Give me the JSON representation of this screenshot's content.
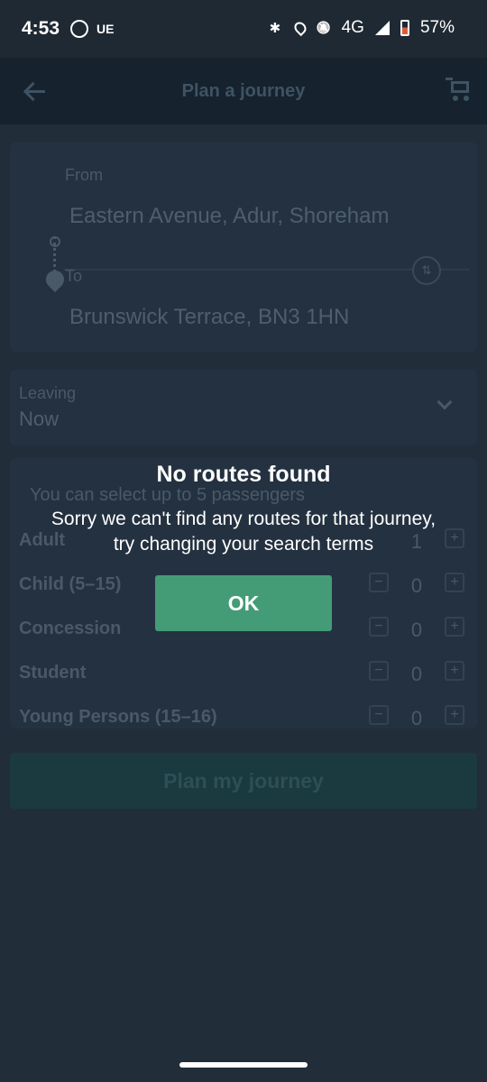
{
  "status_bar": {
    "time": "4:53",
    "carrier_icon": "UE",
    "network": "4G",
    "battery": "57%",
    "icons": [
      "whatsapp-icon",
      "bluetooth-icon",
      "location-icon",
      "bell-off-icon",
      "signal-icon",
      "battery-icon"
    ]
  },
  "app_bar": {
    "title": "Plan a journey",
    "back_icon": "arrow-left",
    "cart_icon": "shopping-cart"
  },
  "journey": {
    "from_label": "From",
    "from_value": "Eastern Avenue, Adur, Shoreham",
    "to_label": "To",
    "to_value": "Brunswick Terrace, BN3 1HN",
    "swap_icon": "swap-vertical"
  },
  "leaving": {
    "label": "Leaving",
    "value": "Now"
  },
  "passengers": {
    "hint": "You can select up to 5 passengers",
    "minus_symbol": "−",
    "plus_symbol": "+",
    "rows": [
      {
        "name": "Adult",
        "count": "1"
      },
      {
        "name": "Child (5–15)",
        "count": "0"
      },
      {
        "name": "Concession",
        "count": "0"
      },
      {
        "name": "Student",
        "count": "0"
      },
      {
        "name": "Young Persons (15–16)",
        "count": "0"
      }
    ]
  },
  "plan_button": "Plan my journey",
  "dialog": {
    "title": "No routes found",
    "message_line1": "Sorry we can't find any routes for that journey,",
    "message_line2": "try changing your search terms",
    "ok_label": "OK"
  },
  "colors": {
    "accent": "#449c77",
    "background": "#222d3a",
    "appbar": "#16222d"
  }
}
